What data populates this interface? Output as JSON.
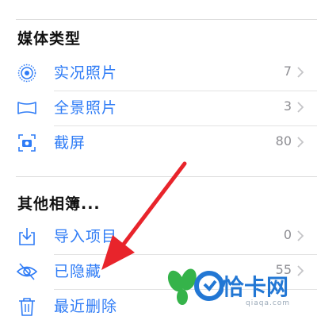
{
  "sections": {
    "media_types": {
      "title": "媒体类型",
      "items": [
        {
          "label": "实况照片",
          "count": "7",
          "icon": "live-photo-icon"
        },
        {
          "label": "全景照片",
          "count": "3",
          "icon": "panorama-icon"
        },
        {
          "label": "截屏",
          "count": "80",
          "icon": "screenshot-icon"
        }
      ]
    },
    "other_albums": {
      "title": "其他相簿...",
      "items": [
        {
          "label": "导入项目",
          "count": "0",
          "icon": "import-icon"
        },
        {
          "label": "已隐藏",
          "count": "55",
          "icon": "hidden-eye-icon"
        },
        {
          "label": "最近删除",
          "count": "",
          "icon": "trash-icon"
        }
      ]
    }
  },
  "colors": {
    "accent": "#2f7cf6",
    "annotation_arrow": "#e8242b",
    "watermark": "#2277d4",
    "watermark_leaf": "#35b34a"
  },
  "watermark": {
    "text": "恰卡网",
    "sub": "qiaqa.com"
  }
}
